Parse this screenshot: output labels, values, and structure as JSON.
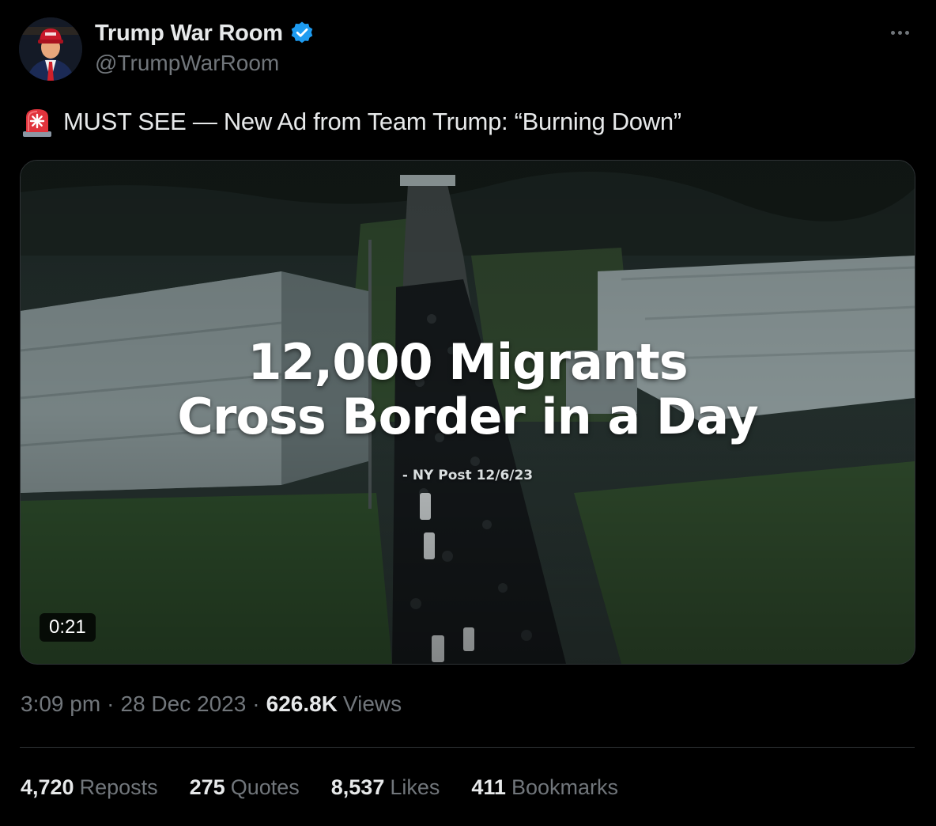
{
  "author": {
    "display_name": "Trump War Room",
    "handle": "@TrumpWarRoom",
    "verified": true
  },
  "tweet": {
    "text": "MUST SEE — New Ad from Team Trump: “Burning Down”",
    "emoji_icon": "rotating-siren-icon"
  },
  "media": {
    "type": "video",
    "overlay_line1": "12,000 Migrants",
    "overlay_line2": "Cross Border in a Day",
    "overlay_source": "- NY Post 12/6/23",
    "duration": "0:21"
  },
  "meta": {
    "time": "3:09 pm",
    "date": "28 Dec 2023",
    "views_count": "626.8K",
    "views_label": "Views"
  },
  "stats": [
    {
      "count": "4,720",
      "label": "Reposts"
    },
    {
      "count": "275",
      "label": "Quotes"
    },
    {
      "count": "8,537",
      "label": "Likes"
    },
    {
      "count": "411",
      "label": "Bookmarks"
    }
  ],
  "colors": {
    "background": "#000000",
    "primary_text": "#e7e9ea",
    "secondary_text": "#71767b",
    "verified_badge": "#1d9bf0",
    "divider": "#2f3336"
  }
}
